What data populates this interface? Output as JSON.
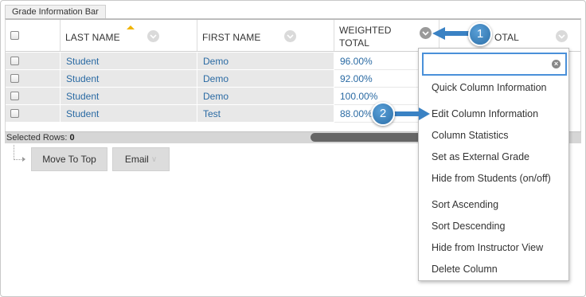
{
  "info_bar": {
    "tab_label": "Grade Information Bar"
  },
  "columns": [
    {
      "label": "LAST NAME",
      "sorted": "ascending"
    },
    {
      "label": "FIRST NAME"
    },
    {
      "label_line1": "WEIGHTED",
      "label_line2": "TOTAL"
    },
    {
      "label": "TOTAL",
      "partial_visible": "OTAL"
    }
  ],
  "rows": [
    {
      "last_name": "Student",
      "first_name": "Demo",
      "weighted_total": "96.00%"
    },
    {
      "last_name": "Student",
      "first_name": "Demo",
      "weighted_total": "92.00%"
    },
    {
      "last_name": "Student",
      "first_name": "Demo",
      "weighted_total": "100.00%"
    },
    {
      "last_name": "Student",
      "first_name": "Test",
      "weighted_total": "88.00%"
    }
  ],
  "selected_rows": {
    "label": "Selected Rows:",
    "count": "0"
  },
  "buttons": {
    "move_to_top": "Move To Top",
    "email": "Email"
  },
  "context_menu": {
    "search_value": "",
    "items": [
      "Quick Column Information",
      "Edit Column Information",
      "Column Statistics",
      "Set as External Grade",
      "Hide from Students (on/off)",
      "Sort Ascending",
      "Sort Descending",
      "Hide from Instructor View",
      "Delete Column"
    ]
  },
  "callouts": {
    "step1": "1",
    "step2": "2"
  },
  "colors": {
    "link": "#2a6aa3",
    "row_bg": "#e8e8e8",
    "sort_indicator": "#f0b400",
    "callout": "#3a82c4",
    "focus_border": "#4a90d9"
  },
  "icons": [
    "chevron-down-icon",
    "sort-ascending-icon",
    "clear-search-icon",
    "tree-connector-icon"
  ]
}
